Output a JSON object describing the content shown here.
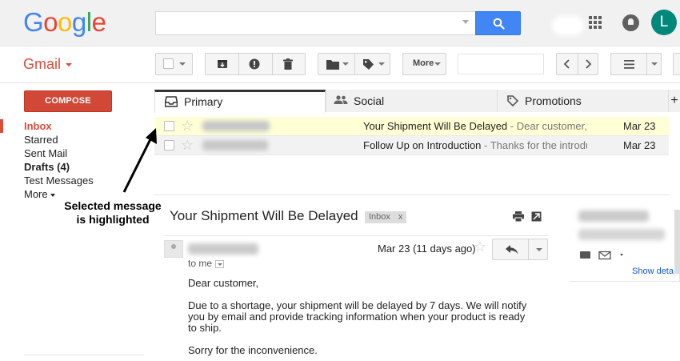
{
  "header": {
    "logo": "Google",
    "logo_colors": [
      "#4285f4",
      "#ea4335",
      "#fbbc05",
      "#4285f4",
      "#34a853",
      "#ea4335"
    ],
    "search": {
      "value": "",
      "placeholder": ""
    },
    "avatar_letter": "L",
    "avatar_color": "#00897b",
    "icons": [
      "search-icon",
      "apps-grid-icon",
      "notifications-icon"
    ]
  },
  "toolbar": {
    "app_label": "Gmail",
    "more_label": "More",
    "icons": [
      "select-checkbox",
      "archive-icon",
      "report-spam-icon",
      "delete-icon",
      "move-to-folder-icon",
      "label-icon",
      "older-chevron-icon",
      "newer-chevron-icon",
      "density-icon"
    ]
  },
  "nav": {
    "compose_label": "COMPOSE",
    "items": [
      {
        "label": "Inbox",
        "active": true
      },
      {
        "label": "Starred"
      },
      {
        "label": "Sent Mail"
      },
      {
        "label": "Drafts (4)",
        "bold": true
      },
      {
        "label": "Test Messages"
      },
      {
        "label": "More"
      }
    ]
  },
  "tabs": [
    {
      "label": "Primary",
      "icon": "inbox-tray-icon",
      "active": true
    },
    {
      "label": "Social",
      "icon": "people-icon"
    },
    {
      "label": "Promotions",
      "icon": "tag-icon"
    }
  ],
  "add_tab_label": "+",
  "messages": [
    {
      "subject": "Your Shipment Will Be Delayed",
      "snippet": " - Dear customer, D",
      "date": "Mar 23",
      "selected": true
    },
    {
      "subject": "Follow Up on Introduction",
      "snippet": " - Thanks for the introduct",
      "date": "Mar 23",
      "selected": false
    }
  ],
  "annotation": {
    "line1": "Selected message",
    "line2": "is highlighted"
  },
  "reading_pane": {
    "subject": "Your Shipment Will Be Delayed",
    "label": "Inbox",
    "label_close": "x",
    "to": "to me",
    "date": "Mar 23 (11 days ago)",
    "body": [
      "Dear customer,",
      "Due to a shortage, your shipment will be delayed by 7 days. We will notify you by email and provide tracking information when your product is ready to ship.",
      "Sorry for the inconvenience."
    ]
  },
  "contact_card": {
    "show_details": "Show deta"
  },
  "colors": {
    "accent": "#dd4b39",
    "selected_row": "#ffffd5",
    "link": "#1155cc"
  }
}
